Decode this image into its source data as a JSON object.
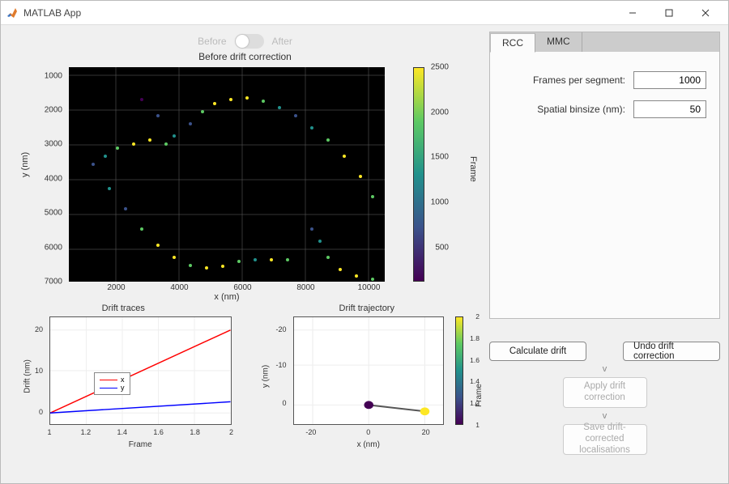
{
  "window": {
    "title": "MATLAB App"
  },
  "switch": {
    "before": "Before",
    "after": "After"
  },
  "main_chart": {
    "title": "Before drift correction",
    "xlabel": "x (nm)",
    "ylabel": "y (nm)",
    "xticks": [
      "2000",
      "4000",
      "6000",
      "8000",
      "10000"
    ],
    "yticks": [
      "1000",
      "2000",
      "3000",
      "4000",
      "5000",
      "6000",
      "7000"
    ],
    "cb_label": "Frame",
    "cb_ticks": [
      "500",
      "1000",
      "1500",
      "2000",
      "2500"
    ]
  },
  "traces_chart": {
    "title": "Drift traces",
    "xlabel": "Frame",
    "ylabel": "Drift (nm)",
    "xticks": [
      "1",
      "1.2",
      "1.4",
      "1.6",
      "1.8",
      "2"
    ],
    "yticks": [
      "0",
      "10",
      "20"
    ],
    "legend": [
      "x",
      "y"
    ]
  },
  "traj_chart": {
    "title": "Drift trajectory",
    "xlabel": "x (nm)",
    "ylabel": "y (nm)",
    "xticks": [
      "-20",
      "0",
      "20"
    ],
    "yticks": [
      "-20",
      "-10",
      "0"
    ],
    "cb_label": "Frame",
    "cb_ticks": [
      "1",
      "1.2",
      "1.4",
      "1.6",
      "1.8",
      "2"
    ]
  },
  "tabs": {
    "rcc": "RCC",
    "mmc": "MMC"
  },
  "form": {
    "fps_label": "Frames per segment:",
    "fps_value": "1000",
    "bin_label": "Spatial binsize (nm):",
    "bin_value": "50"
  },
  "buttons": {
    "calc": "Calculate drift",
    "undo": "Undo drift correction",
    "apply": "Apply drift correction",
    "save": "Save drift-corrected localisations",
    "v": "v"
  },
  "chart_data": [
    {
      "type": "scatter",
      "name": "before_drift_correction",
      "title": "Before drift correction",
      "xlabel": "x (nm)",
      "ylabel": "y (nm)",
      "xlim": [
        500,
        10500
      ],
      "ylim": [
        7000,
        500
      ],
      "colorbar_label": "Frame",
      "clim": [
        1,
        2500
      ],
      "note": "dense point cloud of single-molecule localisations colored by frame; not enumerable"
    },
    {
      "type": "line",
      "name": "drift_traces",
      "title": "Drift traces",
      "xlabel": "Frame",
      "ylabel": "Drift (nm)",
      "xlim": [
        1,
        2
      ],
      "ylim": [
        -3,
        23
      ],
      "series": [
        {
          "name": "x",
          "color": "#ff0000",
          "x": [
            1,
            2
          ],
          "y": [
            0,
            20
          ]
        },
        {
          "name": "y",
          "color": "#0000ff",
          "x": [
            1,
            2
          ],
          "y": [
            0,
            3
          ]
        }
      ]
    },
    {
      "type": "line",
      "name": "drift_trajectory",
      "title": "Drift trajectory",
      "xlabel": "x (nm)",
      "ylabel": "y (nm)",
      "xlim": [
        -25,
        25
      ],
      "ylim": [
        -25,
        5
      ],
      "colorbar_label": "Frame",
      "clim": [
        1,
        2
      ],
      "points": [
        {
          "x": 0,
          "y": 0,
          "frame": 1
        },
        {
          "x": 20,
          "y": -3,
          "frame": 2
        }
      ]
    }
  ]
}
